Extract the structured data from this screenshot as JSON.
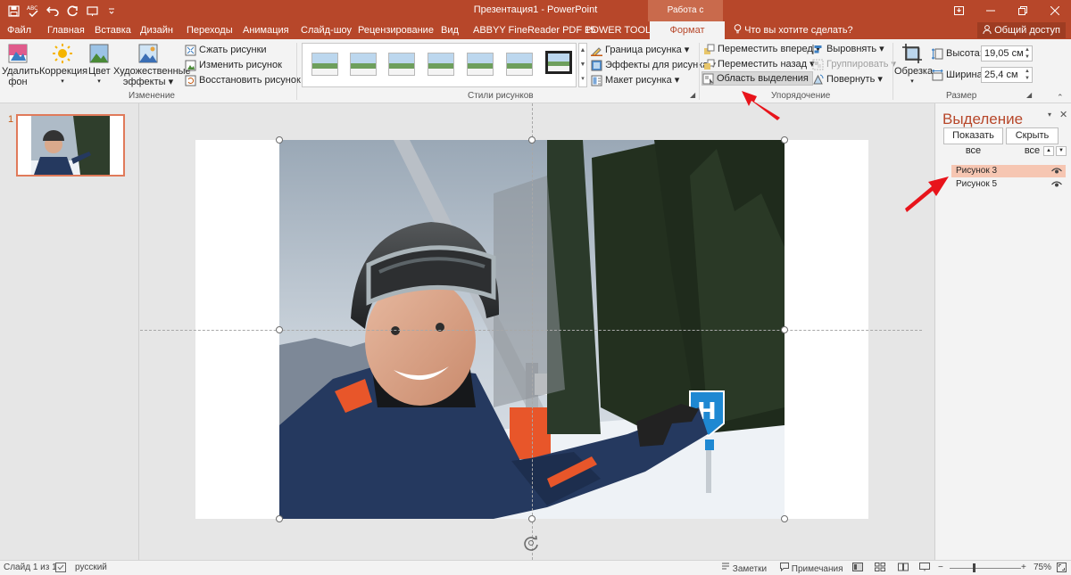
{
  "titlebar": {
    "title": "Презентация1 - PowerPoint",
    "context_group": "Работа с рисунками",
    "qat_icons": [
      "save-icon",
      "spellcheck-icon",
      "undo-icon",
      "redo-icon",
      "present-icon",
      "customize-icon"
    ]
  },
  "tabs": {
    "items": [
      {
        "label": "Файл"
      },
      {
        "label": "Главная"
      },
      {
        "label": "Вставка"
      },
      {
        "label": "Дизайн"
      },
      {
        "label": "Переходы"
      },
      {
        "label": "Анимация"
      },
      {
        "label": "Слайд-шоу"
      },
      {
        "label": "Рецензирование"
      },
      {
        "label": "Вид"
      },
      {
        "label": "ABBYY FineReader PDF 15"
      },
      {
        "label": "POWER TOOLS"
      },
      {
        "label": "Формат"
      }
    ],
    "active": "Формат",
    "tell_me": "Что вы хотите сделать?",
    "share": "Общий доступ"
  },
  "ribbon": {
    "adjust": {
      "remove_bg": "Удалить фон",
      "corrections": "Коррекция",
      "color": "Цвет",
      "artistic": "Художественные эффекты",
      "compress": "Сжать рисунки",
      "change": "Изменить рисунок",
      "reset": "Восстановить рисунок",
      "label": "Изменение"
    },
    "styles": {
      "label": "Стили рисунков",
      "border": "Граница рисунка",
      "effects": "Эффекты для рисунка",
      "layout": "Макет рисунка"
    },
    "arrange": {
      "label": "Упорядочение",
      "bring_forward": "Переместить вперед",
      "send_backward": "Переместить назад",
      "selection_pane": "Область выделения",
      "align": "Выровнять",
      "group": "Группировать",
      "rotate": "Повернуть"
    },
    "size": {
      "label": "Размер",
      "crop": "Обрезка",
      "height_label": "Высота:",
      "height": "19,05 см",
      "width_label": "Ширина:",
      "width": "25,4 см"
    }
  },
  "thumbs": {
    "slide_number": "1"
  },
  "selection_pane": {
    "title": "Выделение",
    "show_all": "Показать все",
    "hide_all": "Скрыть все",
    "items": [
      {
        "name": "Рисунок 3",
        "selected": true
      },
      {
        "name": "Рисунок 5",
        "selected": false
      }
    ]
  },
  "status": {
    "slide": "Слайд 1 из 1",
    "language": "русский",
    "notes": "Заметки",
    "comments": "Примечания",
    "zoom": "75%"
  },
  "colors": {
    "accent": "#b7472a",
    "annotation_arrow": "#e8141b"
  }
}
